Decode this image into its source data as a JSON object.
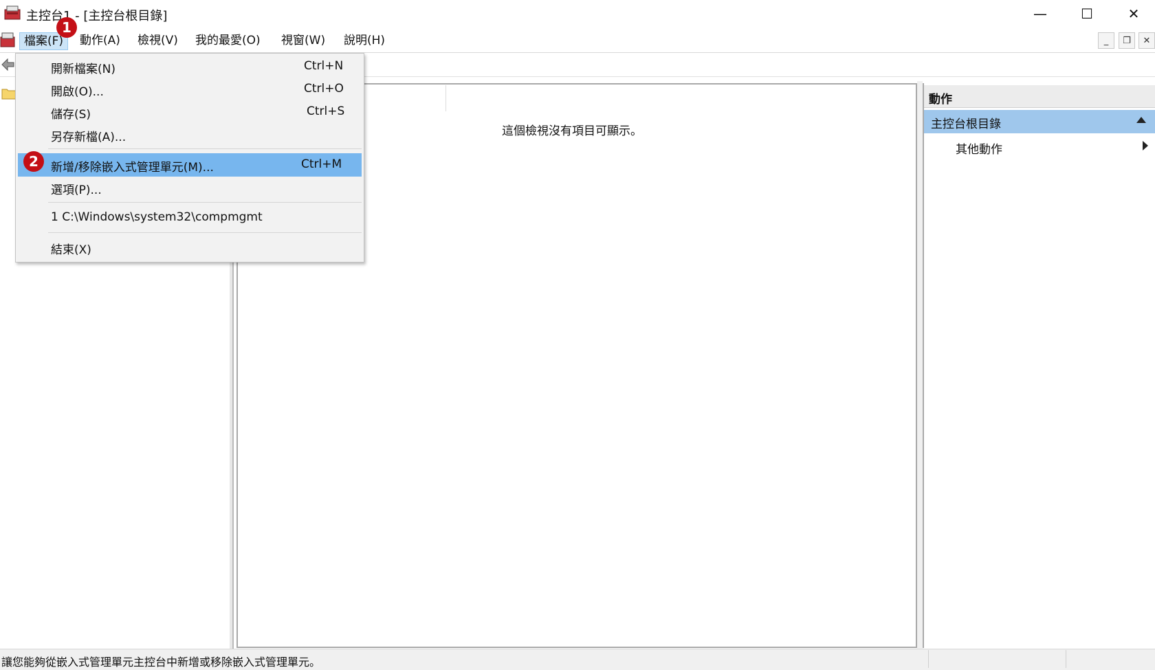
{
  "window": {
    "title": "主控台1 - [主控台根目錄]",
    "controls": {
      "minimize": "—",
      "maximize": "☐",
      "close": "✕"
    }
  },
  "menubar": {
    "items": [
      "檔案(F)",
      "動作(A)",
      "檢視(V)",
      "我的最愛(O)",
      "視窗(W)",
      "說明(H)"
    ],
    "mdi_controls": {
      "minimize": "_",
      "restore": "❐",
      "close": "✕"
    }
  },
  "file_menu": {
    "items": [
      {
        "label": "開新檔案(N)",
        "accel": "Ctrl+N"
      },
      {
        "label": "開啟(O)...",
        "accel": "Ctrl+O"
      },
      {
        "label": "儲存(S)",
        "accel": "Ctrl+S"
      },
      {
        "label": "另存新檔(A)...",
        "accel": ""
      },
      {
        "label": "新增/移除嵌入式管理單元(M)...",
        "accel": "Ctrl+M"
      },
      {
        "label": "選項(P)...",
        "accel": ""
      },
      {
        "label": "1 C:\\Windows\\system32\\compmgmt",
        "accel": ""
      },
      {
        "label": "結束(X)",
        "accel": ""
      }
    ],
    "highlighted_index": 4
  },
  "center": {
    "empty_message": "這個檢視沒有項目可顯示。"
  },
  "actions": {
    "header": "動作",
    "section": "主控台根目錄",
    "more": "其他動作"
  },
  "status": {
    "text": "讓您能夠從嵌入式管理單元主控台中新增或移除嵌入式管理單元。"
  },
  "callouts": [
    "1",
    "2"
  ],
  "colors": {
    "highlight": "#77b6ee",
    "section": "#9fc7ec",
    "badge": "#c40f16"
  }
}
